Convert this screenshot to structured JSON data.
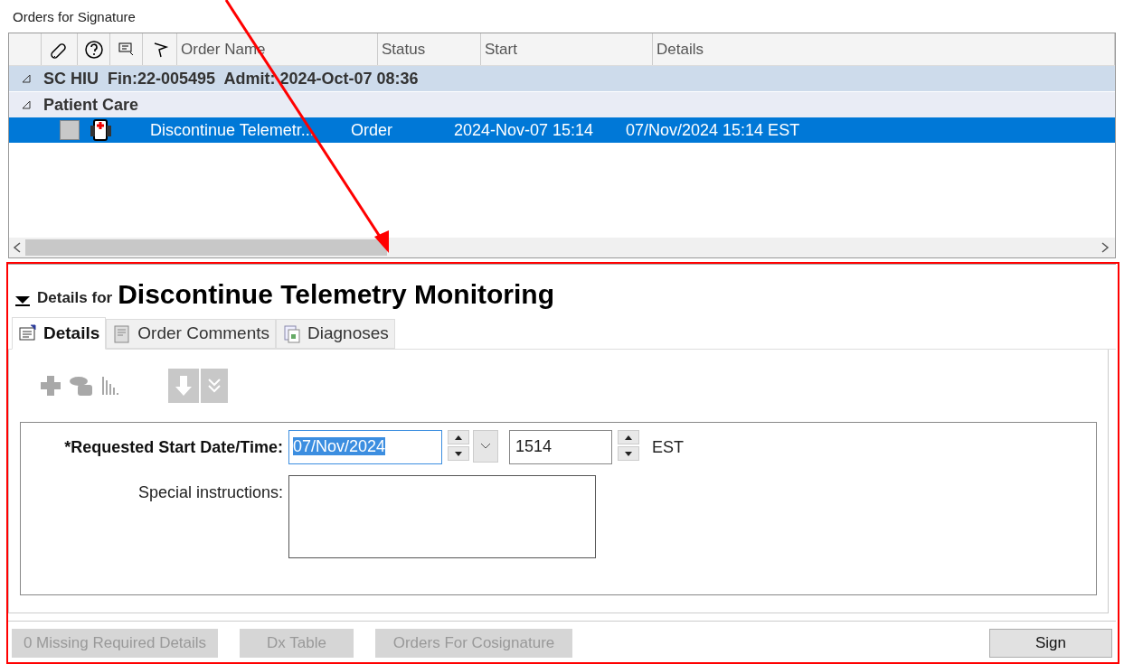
{
  "list_title": "Orders for Signature",
  "table": {
    "columns": [
      {
        "kind": "icon"
      },
      {
        "kind": "icon"
      },
      {
        "kind": "icon"
      },
      {
        "kind": "icon"
      },
      {
        "kind": "text",
        "label": "Order Name"
      },
      {
        "kind": "text",
        "label": "Status"
      },
      {
        "kind": "text",
        "label": "Start"
      },
      {
        "kind": "text",
        "label": "Details"
      }
    ],
    "groups": [
      {
        "label": "SC HIU  Fin:22-005495  Admit: 2024-Oct-07 08:36",
        "expanded": true,
        "children": [
          {
            "label": "Patient Care",
            "expanded": true,
            "rows": [
              {
                "checked": false,
                "selected": true,
                "order_name": "Discontinue Telemetr...",
                "status": "Order",
                "start": "2024-Nov-07 15:14",
                "details": "07/Nov/2024 15:14 EST"
              }
            ]
          }
        ]
      }
    ]
  },
  "details": {
    "expanded": true,
    "prefix": "Details for",
    "title": "Discontinue Telemetry Monitoring",
    "tabs": [
      {
        "label": "Details",
        "selected": true
      },
      {
        "label": "Order Comments",
        "selected": false
      },
      {
        "label": "Diagnoses",
        "selected": false
      }
    ],
    "fields": [
      {
        "label": "*Requested Start Date/Time:",
        "required": true,
        "date": "07/Nov/2024",
        "time": "1514",
        "zone": "EST"
      },
      {
        "label": "Special instructions:",
        "required": false
      }
    ]
  },
  "buttons": [
    {
      "label": "0 Missing Required Details",
      "disabled": true
    },
    {
      "label": "Dx Table",
      "disabled": true
    },
    {
      "label": "Orders For Cosignature",
      "disabled": true
    },
    {
      "label": "Sign",
      "disabled": false
    }
  ]
}
